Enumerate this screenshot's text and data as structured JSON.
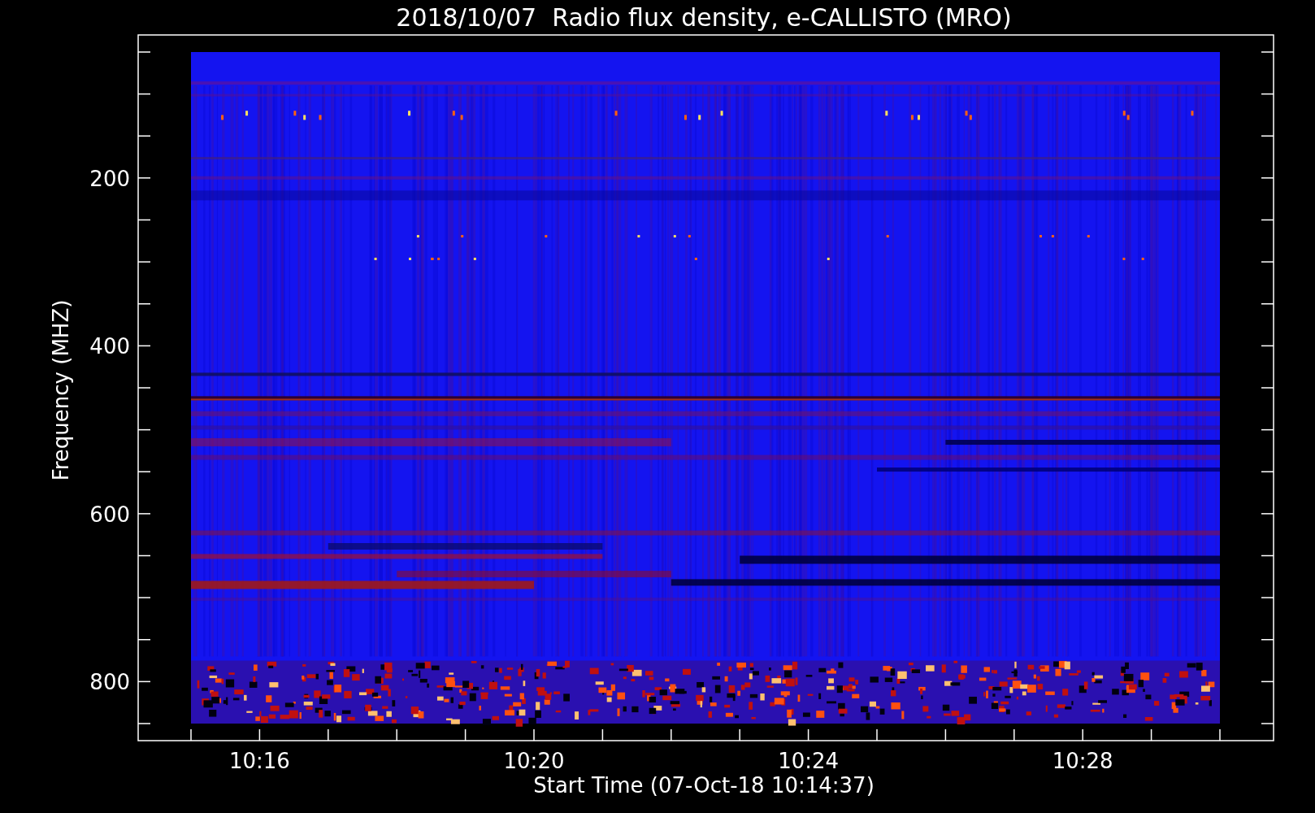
{
  "title": "2018/10/07  Radio flux density, e-CALLISTO (MRO)",
  "plot": {
    "xlabel": "Start Time (07-Oct-18 10:14:37)",
    "ylabel": "Frequency (MHZ)",
    "xtick_labels": [
      "10:16",
      "10:20",
      "10:24",
      "10:28"
    ],
    "ytick_labels": [
      "200",
      "400",
      "600",
      "800"
    ]
  }
}
